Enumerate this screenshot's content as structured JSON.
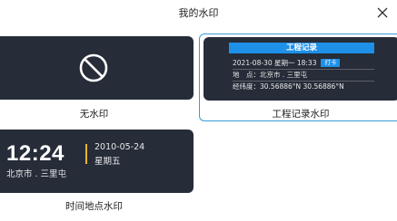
{
  "header": {
    "title": "我的水印",
    "close_icon": "close-icon"
  },
  "watermarks": {
    "none": {
      "label": "无水印",
      "icon": "ban-icon"
    },
    "engineering": {
      "label": "工程记录水印",
      "selected": true,
      "preview": {
        "title": "工程记录",
        "datetime": "2021-08-30 星期一 18:33",
        "badge": "打卡",
        "location_label": "地　点：",
        "location_value": "北京市 . 三里屯",
        "coords_label": "经纬度：",
        "coords_value": "30.56886°N  30.56886°N"
      }
    },
    "time_location": {
      "label": "时间地点水印",
      "preview": {
        "time": "12:24",
        "date": "2010-05-24",
        "weekday": "星期五",
        "location": "北京市 . 三里屯"
      }
    }
  },
  "colors": {
    "card_bg": "#262c38",
    "accent_blue": "#1e90e8",
    "selected_border": "#3b9bd8",
    "time_bar": "#f1b22b"
  }
}
